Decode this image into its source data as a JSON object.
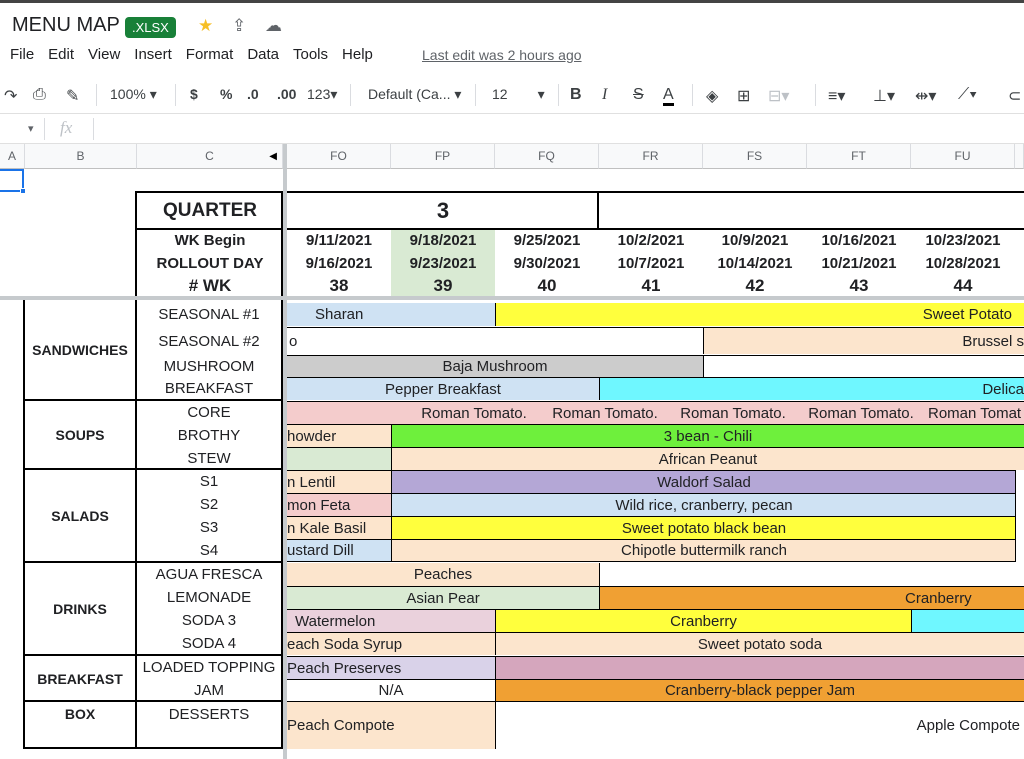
{
  "app": {
    "doc_title": "MENU MAP",
    "file_badge": ".XLSX",
    "last_edit": "Last edit was 2 hours ago"
  },
  "menus": [
    "File",
    "Edit",
    "View",
    "Insert",
    "Format",
    "Data",
    "Tools",
    "Help"
  ],
  "toolbar": {
    "zoom": "100%",
    "currency": "$",
    "percent": "%",
    "dec_less": ".0",
    "dec_more": ".00",
    "num_format": "123",
    "font": "Default (Ca...",
    "font_size": "12",
    "bold": "B",
    "italic": "I",
    "strike": "S",
    "text_color": "A"
  },
  "formula_bar": {
    "fx": "fx"
  },
  "columns": [
    "A",
    "B",
    "C",
    "FO",
    "FP",
    "FQ",
    "FR",
    "FS",
    "FT",
    "FU"
  ],
  "header": {
    "quarter_label": "QUARTER",
    "quarter_value": "3",
    "wk_begin_label": "WK Begin",
    "rollout_label": "ROLLOUT DAY",
    "wk_num_label": "# WK",
    "wk_begin": [
      "9/11/2021",
      "9/18/2021",
      "9/25/2021",
      "10/2/2021",
      "10/9/2021",
      "10/16/2021",
      "10/23/2021"
    ],
    "rollout": [
      "9/16/2021",
      "9/23/2021",
      "9/30/2021",
      "10/7/2021",
      "10/14/2021",
      "10/21/2021",
      "10/28/2021"
    ],
    "weeks": [
      "38",
      "39",
      "40",
      "41",
      "42",
      "43",
      "44"
    ]
  },
  "categories": {
    "sandwiches": "SANDWICHES",
    "soups": "SOUPS",
    "salads": "SALADS",
    "drinks": "DRINKS",
    "breakfast": "BREAKFAST",
    "box": "BOX"
  },
  "rows": {
    "seasonal1": "SEASONAL #1",
    "seasonal2": "SEASONAL #2",
    "mushroom": "MUSHROOM",
    "breakfast": "BREAKFAST",
    "core": "CORE",
    "brothy": "BROTHY",
    "stew": "STEW",
    "s1": "S1",
    "s2": "S2",
    "s3": "S3",
    "s4": "S4",
    "agua": "AGUA FRESCA",
    "lemonade": "LEMONADE",
    "soda3": "SODA 3",
    "soda4": "SODA 4",
    "loaded": "LOADED TOPPING",
    "jam": "JAM",
    "desserts": "DESSERTS"
  },
  "items": {
    "sharan": "Sharan",
    "sweet_potato": "Sweet Potato",
    "o": "o",
    "brussel": "Brussel s",
    "baja": "Baja Mushroom",
    "pepper_breakfast": "Pepper Breakfast",
    "delica": "Delica",
    "roman1": "Roman Tomato.",
    "roman2": "Roman Tomato.",
    "roman3": "Roman Tomato.",
    "roman4": "Roman Tomato.",
    "roman5": "Roman Tomat",
    "chowder": "howder",
    "chili": "3 bean - Chili",
    "african": "African Peanut",
    "lentil": "n Lentil",
    "waldorf": "Waldorf Salad",
    "feta": "mon Feta",
    "wildrice": "Wild rice, cranberry, pecan",
    "kale": "n Kale Basil",
    "sp_blackbean": "Sweet potato black bean",
    "mustard": "ustard Dill",
    "chipotle": "Chipotle buttermilk ranch",
    "peaches": "Peaches",
    "asian_pear": "Asian Pear",
    "cranberry_lem": "Cranberry",
    "watermelon": "Watermelon",
    "cranberry_soda": "Cranberry",
    "peach_syrup": "each Soda Syrup",
    "sp_soda": "Sweet potato soda",
    "peach_preserves": "Peach Preserves",
    "na": "N/A",
    "cran_jam": "Cranberry-black pepper Jam",
    "peach_compote": "Peach Compote",
    "apple_compote": "Apple Compote"
  },
  "colors": {
    "light_blue": "#cfe2f3",
    "yellow": "#ffff3d",
    "peach": "#fce5cd",
    "gray": "#cccccc",
    "cyan": "#6ff7ff",
    "pink": "#f4cccc",
    "green": "#6ef03c",
    "purple": "#b4a7d6",
    "light_green": "#d9ead3",
    "orange": "#f0a033",
    "lavender": "#d9d2e9",
    "mauve": "#d5a6bd",
    "week_highlight": "#d9ead3"
  }
}
